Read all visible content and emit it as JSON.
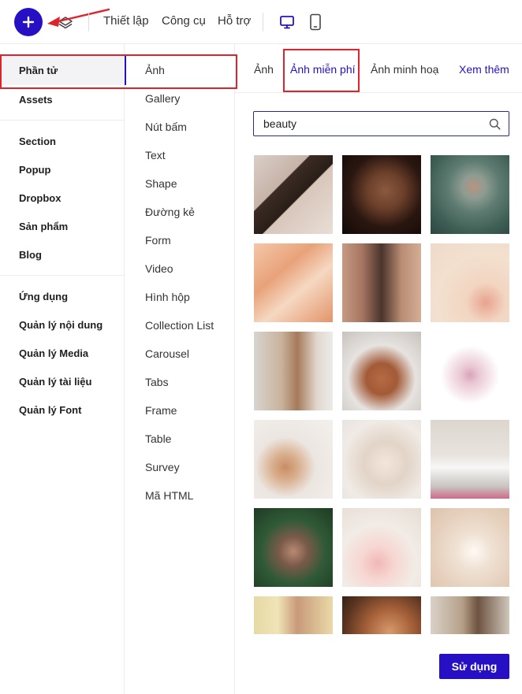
{
  "toolbar": {
    "add_button_icon": "plus-icon",
    "layers_icon": "layers-icon",
    "menu": [
      "Thiết lập",
      "Công cụ",
      "Hỗ trợ"
    ],
    "devices": [
      "desktop-icon",
      "mobile-icon"
    ],
    "accent": "#2710c4"
  },
  "sidebar": {
    "groups": [
      [
        "Phần tử",
        "Assets"
      ],
      [
        "Section",
        "Popup",
        "Dropbox",
        "Sản phẩm",
        "Blog"
      ],
      [
        "Ứng dụng",
        "Quản lý nội dung",
        "Quản lý Media",
        "Quản lý tài liệu",
        "Quản lý Font"
      ]
    ],
    "active": "Phần tử"
  },
  "elements": {
    "items": [
      "Ảnh",
      "Gallery",
      "Nút bấm",
      "Text",
      "Shape",
      "Đường kẻ",
      "Form",
      "Video",
      "Hình hộp",
      "Collection List",
      "Carousel",
      "Tabs",
      "Frame",
      "Table",
      "Survey",
      "Mã HTML"
    ],
    "active": "Ảnh"
  },
  "panel": {
    "tabs": [
      "Ảnh",
      "Ảnh miễn phí",
      "Ảnh minh hoạ",
      "Xem thêm"
    ],
    "active_tab": "Ảnh miễn phí",
    "search_value": "beauty",
    "search_icon": "search-icon",
    "use_button": "Sử dụng",
    "images": [
      "woman-compact-mirror",
      "woman-lips-closeup",
      "woman-behind-leaf",
      "woman-face-blurred",
      "two-women-faces",
      "makeup-brushes-flatlay",
      "woman-long-hair-profile",
      "woman-facial-mask",
      "dried-flowers",
      "makeup-palette-flatlay",
      "spa-towels-flatlay",
      "lotion-bottle-towels",
      "woman-with-leaves",
      "flowers-and-dropper",
      "cream-swatch",
      "woman-smiling-portrait",
      "woman-eye-closeup",
      "woman-towel-mirror"
    ]
  }
}
